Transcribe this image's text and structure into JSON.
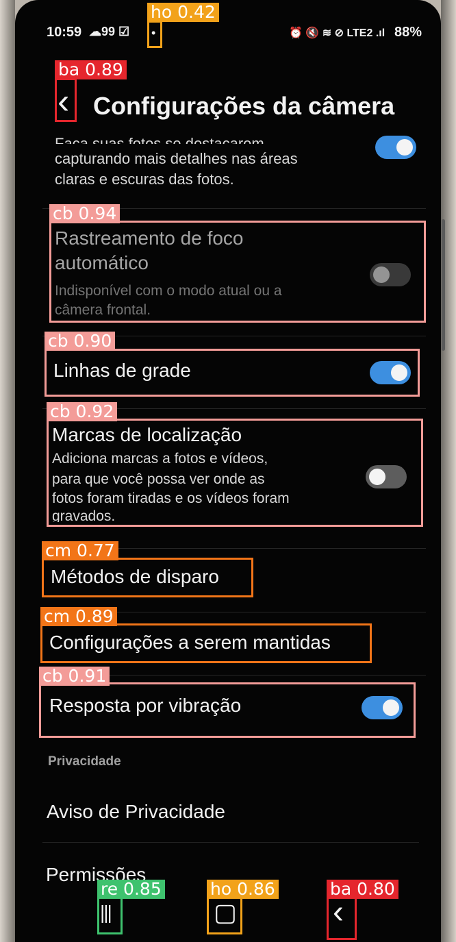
{
  "status_bar": {
    "time": "10:59",
    "left_icons": "☁99 ☑",
    "dot": "•",
    "right_icons": "⏰ 🔇 ≋ ⊘ LTE2 .ıl",
    "battery": "88%"
  },
  "header": {
    "back_glyph": "‹",
    "title": "Configurações da câmera"
  },
  "settings": {
    "top_partial_line": "Faça suas fotos se destacarem",
    "top_line2": "capturando mais detalhes nas áreas",
    "top_line3": "claras e escuras das fotos.",
    "focus_title_1": "Rastreamento de foco",
    "focus_title_2": "automático",
    "focus_sub_1": "Indisponível com o modo atual ou a",
    "focus_sub_2": "câmera frontal.",
    "grid_title": "Linhas de grade",
    "location_title": "Marcas de localização",
    "location_sub_1": "Adiciona marcas a fotos e vídeos,",
    "location_sub_2": "para que você possa ver onde as",
    "location_sub_3": "fotos foram tiradas e os vídeos foram",
    "location_sub_4": "gravados.",
    "shooting_methods": "Métodos de disparo",
    "keep_settings": "Configurações a serem mantidas",
    "vibration": "Resposta por vibração",
    "privacy_header": "Privacidade",
    "privacy_notice": "Aviso de Privacidade",
    "permissions": "Permissões"
  },
  "toggles": {
    "top": "on",
    "focus_tracking": "off",
    "grid_lines": "on",
    "location_tags": "off",
    "vibration": "on"
  },
  "nav": {
    "recents_glyph": "|||",
    "home_glyph": "▢",
    "back_glyph": "‹"
  },
  "detections": [
    {
      "label": "ho 0.42"
    },
    {
      "label": "ba 0.89"
    },
    {
      "label": "cb 0.94"
    },
    {
      "label": "cb 0.90"
    },
    {
      "label": "cb 0.92"
    },
    {
      "label": "cm 0.77"
    },
    {
      "label": "cm 0.89"
    },
    {
      "label": "cb 0.91"
    },
    {
      "label": "re 0.85"
    },
    {
      "label": "ho 0.86"
    },
    {
      "label": "ba 0.80"
    }
  ],
  "colors": {
    "accent_toggle": "#3d8fe0",
    "box_ba": "#e5262d",
    "box_ho": "#f2a21a",
    "box_cb": "#f39c98",
    "box_cm": "#f27518",
    "box_re": "#3ec26e"
  }
}
